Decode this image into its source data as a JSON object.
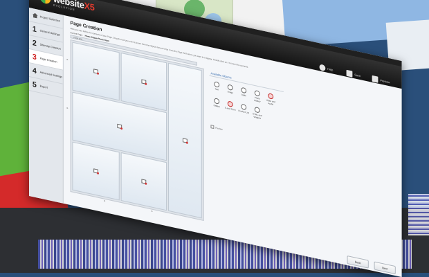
{
  "app": {
    "brand": "website",
    "brand_suffix": "X5",
    "edition": "EVOLUTION"
  },
  "titlebar": {
    "help": "Help",
    "save": "Save",
    "preview": "Preview"
  },
  "sidebar": {
    "items": [
      {
        "num": "",
        "label": "Project Selection"
      },
      {
        "num": "1",
        "label": "General Settings"
      },
      {
        "num": "2",
        "label": "Sitemap Creation"
      },
      {
        "num": "3",
        "label": "Page Creation"
      },
      {
        "num": "4",
        "label": "Advanced Settings"
      },
      {
        "num": "5",
        "label": "Export"
      }
    ]
  },
  "main": {
    "title": "Page Creation",
    "description": "Here you can define the contents of your Page. Drag the tool you want to insert from the Objects list and drop it into the Page Grid where you want it to appear. Double-click on it to insert the contents.",
    "current_page_label": "Current Page:",
    "current_page_value": "Home-Shape-Photo-Impo",
    "toolbar_label": "Page grid",
    "objects_label": "Available Objects",
    "objects": [
      {
        "label": "Text",
        "icon": "text-object-icon"
      },
      {
        "label": "Image",
        "icon": "image-object-icon"
      },
      {
        "label": "Table",
        "icon": "table-object-icon"
      },
      {
        "label": "Photo Gallery",
        "icon": "gallery-object-icon"
      },
      {
        "label": "Video and Audio",
        "icon": "video-object-icon"
      },
      {
        "label": "Gallery",
        "icon": "gallery2-object-icon"
      },
      {
        "label": "E-mail Form",
        "icon": "email-form-icon"
      },
      {
        "label": "Product List",
        "icon": "product-list-icon"
      },
      {
        "label": "HTML and Widgets",
        "icon": "html-widget-icon"
      }
    ],
    "preview_label": "Preview"
  },
  "buttons": {
    "back": "Back",
    "next": "Next"
  },
  "colors": {
    "active_step": "#d02020",
    "titlebar": "#1a1a1a",
    "accent": "#3a6fb0"
  }
}
